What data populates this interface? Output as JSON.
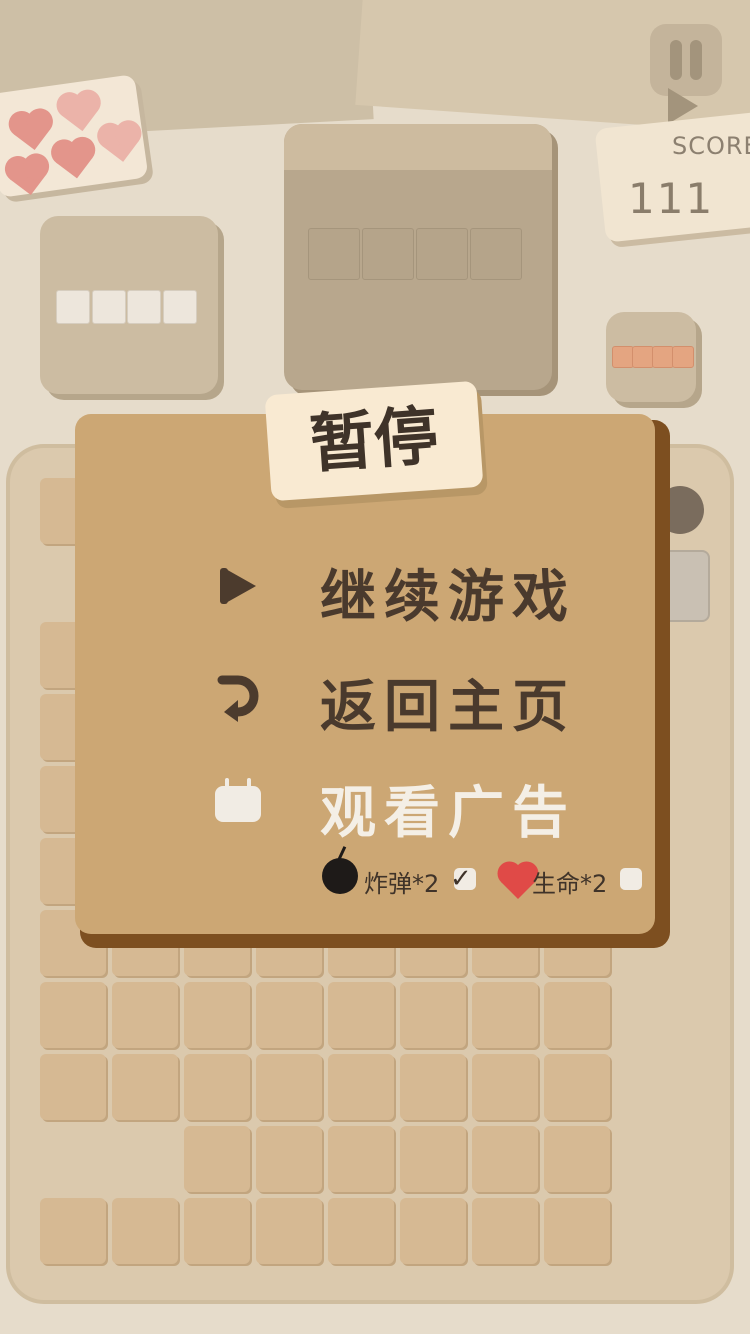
{
  "hud": {
    "score_label": "SCORE",
    "score_value": "111"
  },
  "pause_dialog": {
    "title": "暂停",
    "menu": [
      {
        "label": "继续游戏",
        "icon": "play-icon"
      },
      {
        "label": "返回主页",
        "icon": "return-arrow-icon"
      },
      {
        "label": "观看广告",
        "icon": "tv-icon"
      }
    ],
    "rewards": [
      {
        "icon": "bomb-icon",
        "label": "炸弹*2",
        "checked": true
      },
      {
        "icon": "heart-icon",
        "label": "生命*2",
        "checked": false
      }
    ]
  },
  "colors": {
    "background": "#e6dccb",
    "dialog": "#cca774",
    "dialog_shadow": "#7d4f20",
    "board": "#dbc9ad",
    "board_cell": "#d6b993",
    "text_dark": "#4a3a2d",
    "heart_red": "#e04a47"
  }
}
